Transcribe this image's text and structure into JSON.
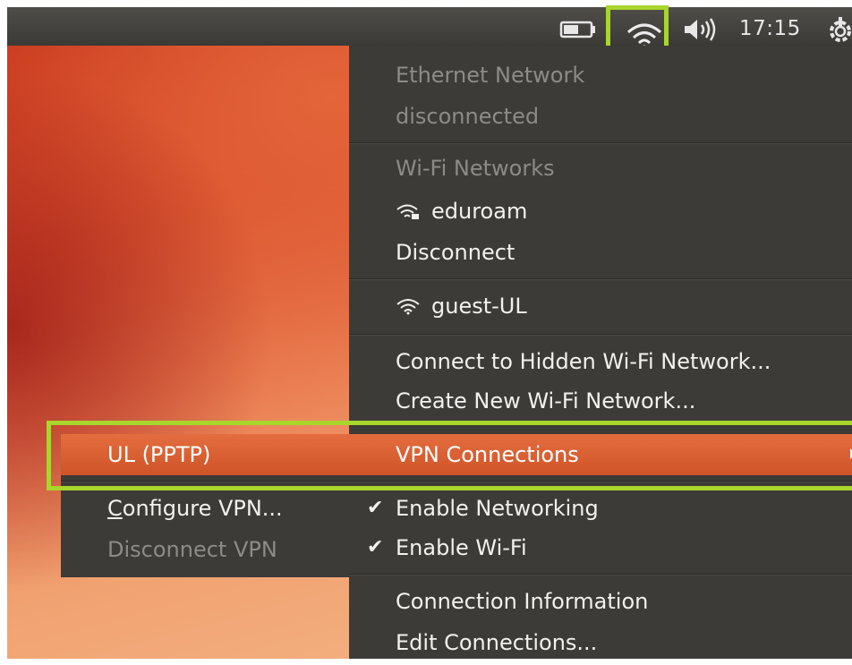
{
  "top_panel": {
    "battery_icon": "battery-icon",
    "wifi_icon": "wifi-icon",
    "volume_icon": "volume-icon",
    "clock": "17:15",
    "session_icon": "power-gear-icon"
  },
  "menu": {
    "ethernet_header": "Ethernet Network",
    "ethernet_status": "disconnected",
    "wifi_header": "Wi-Fi Networks",
    "networks": [
      {
        "name": "eduroam",
        "icon": "wifi-secured-icon"
      },
      {
        "name": "guest-UL",
        "icon": "wifi-icon"
      }
    ],
    "disconnect": "Disconnect",
    "connect_hidden": "Connect to Hidden Wi-Fi Network...",
    "create_new": "Create New Wi-Fi Network...",
    "vpn_connections": "VPN Connections",
    "enable_networking": "Enable Networking",
    "enable_wifi": "Enable Wi-Fi",
    "connection_info": "Connection Information",
    "edit_connections": "Edit Connections..."
  },
  "vpn_submenu": {
    "vpn_name": "UL (PPTP)",
    "configure_mnemonic": "C",
    "configure_rest": "onfigure VPN...",
    "disconnect_vpn": "Disconnect VPN"
  },
  "colors": {
    "highlight_green": "#a8d62c",
    "active_orange": "#dd5f33",
    "menu_bg": "#3c3b37"
  }
}
